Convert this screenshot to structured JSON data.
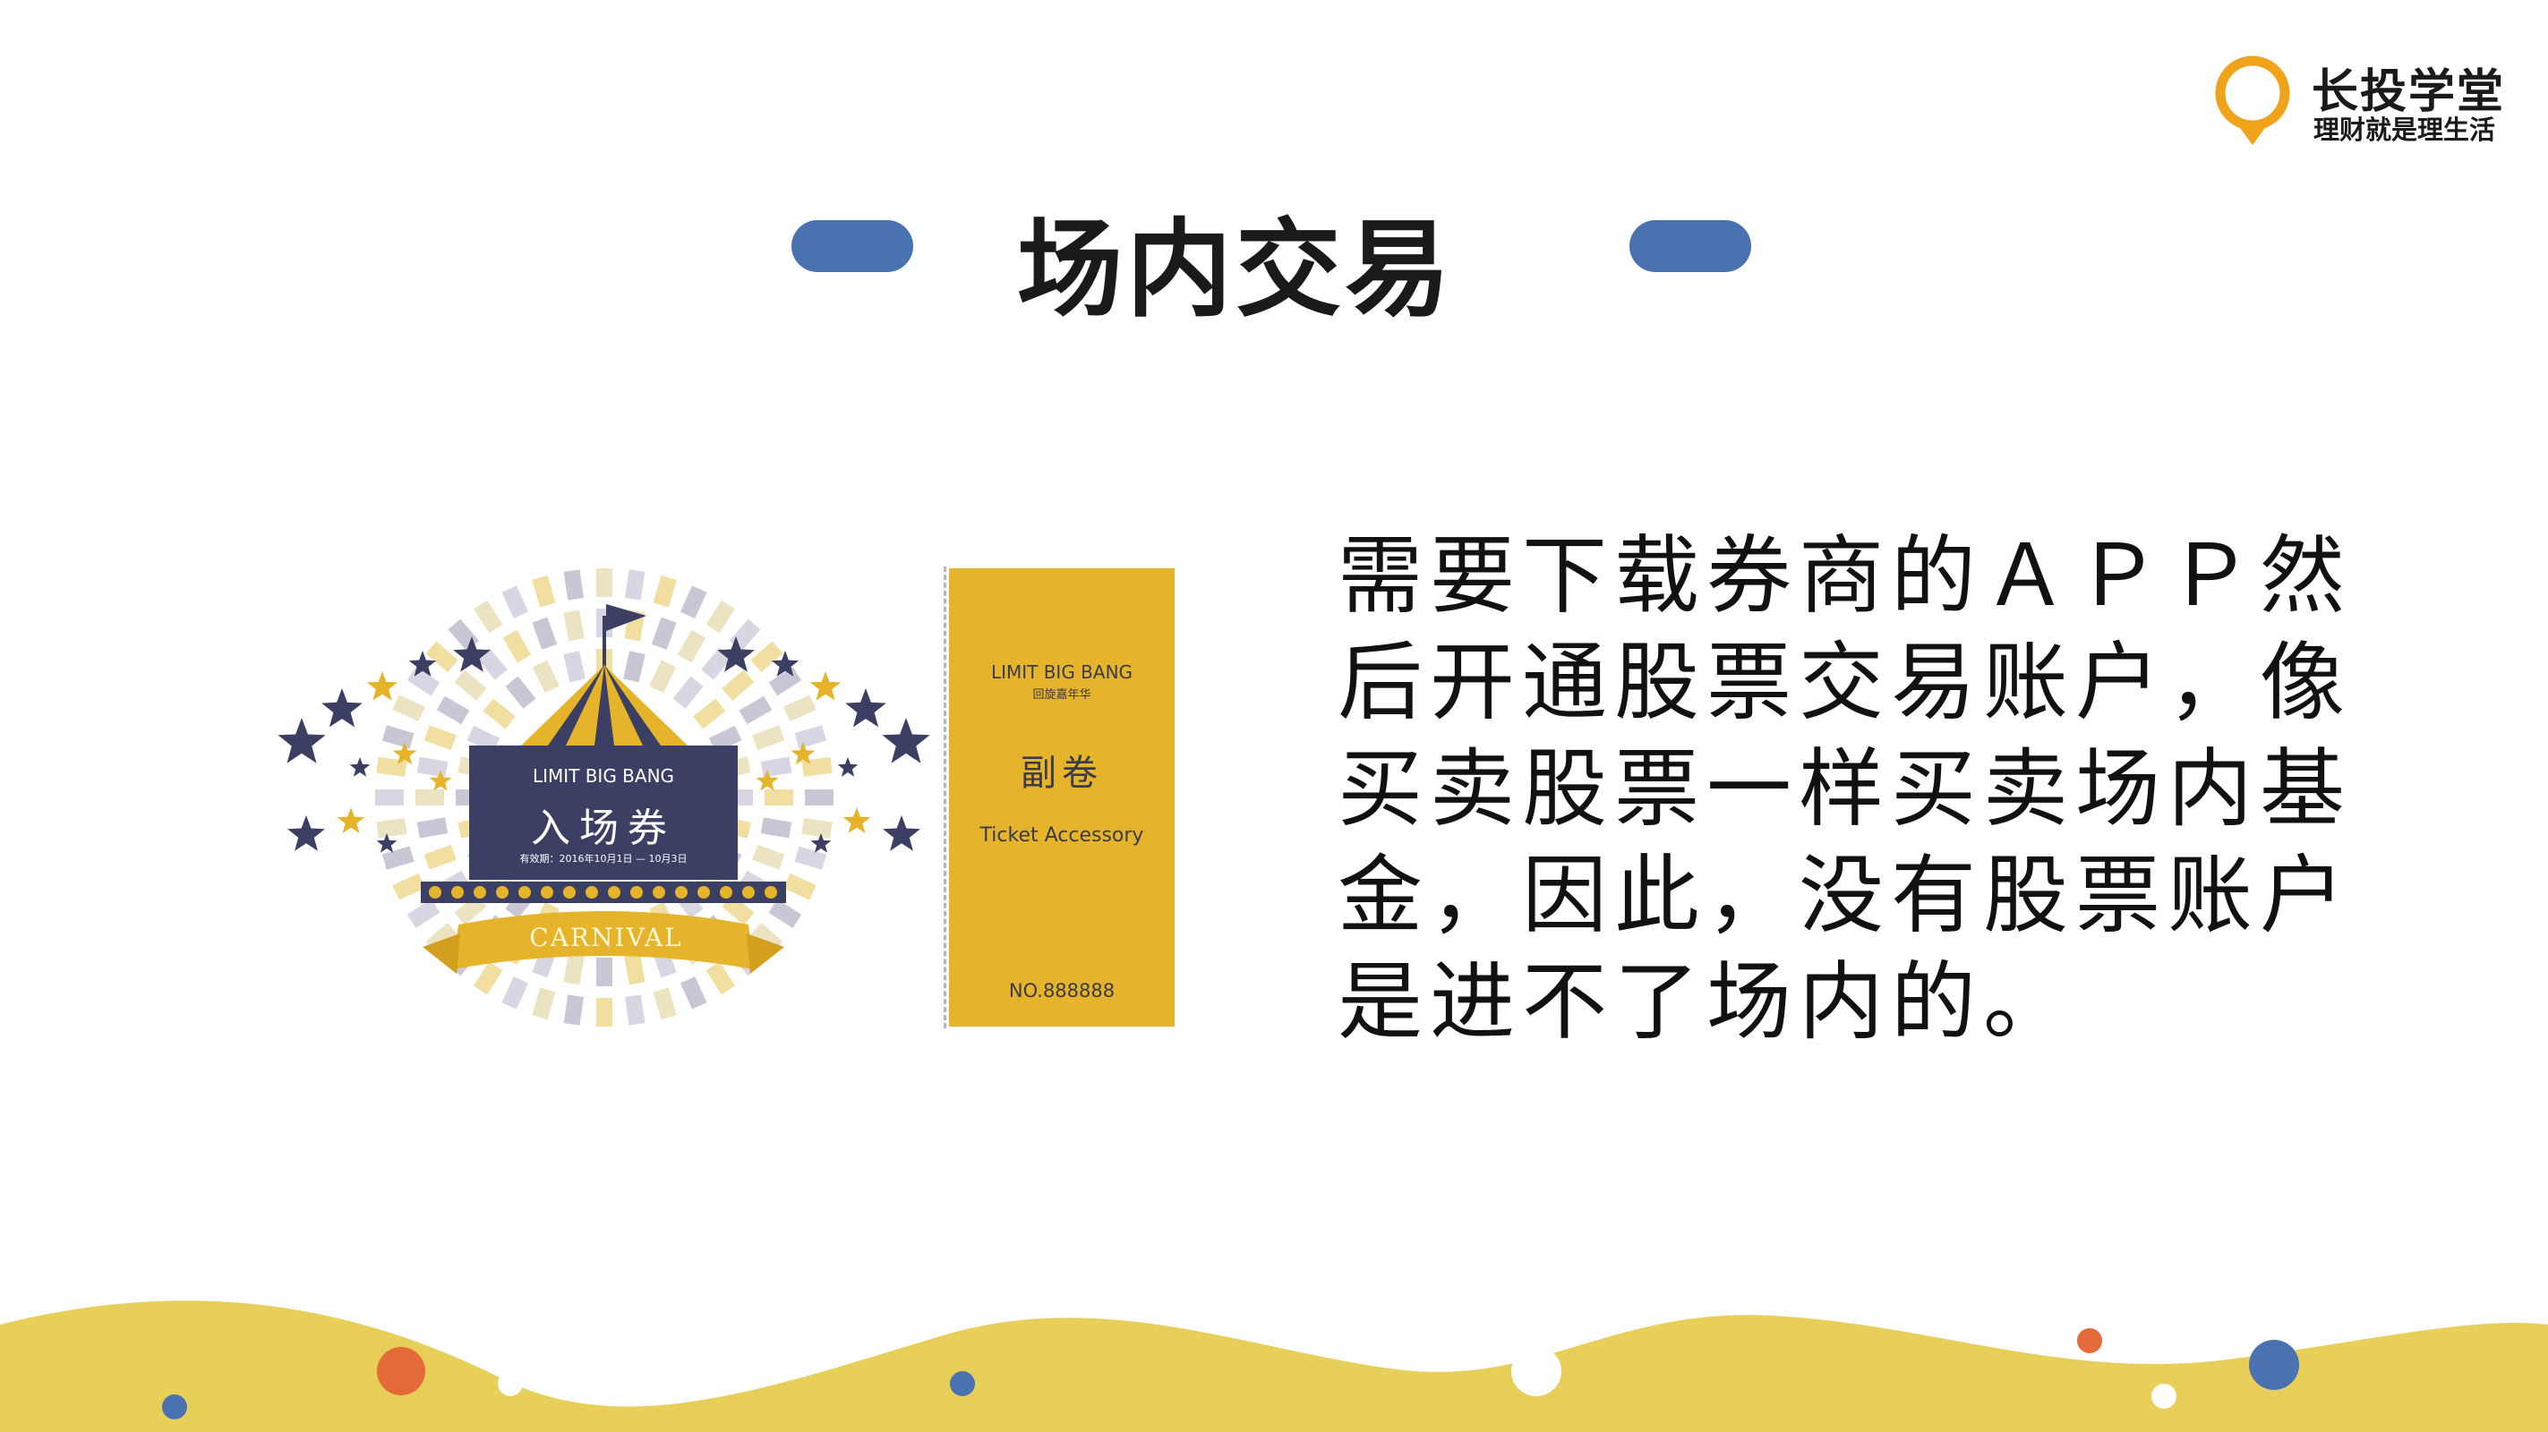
{
  "logo": {
    "name": "长投学堂",
    "slogan": "理财就是理生活",
    "icon": "lightbulb-icon",
    "color": "#f0a21a"
  },
  "slide": {
    "title": "场内交易",
    "accent_color": "#4a72b0",
    "body": "需要下载券商的ＡＰＰ然后开通股票交易账户，像买卖股票一样买卖场内基金，因此，没有股票账户是进不了场内的。"
  },
  "ticket": {
    "main": {
      "brand": "LIMIT BIG BANG",
      "title": "入场券",
      "validity": "有效期：2016年10月1日 — 10月3日",
      "ribbon": "CARNIVAL",
      "navy": "#3b3f63",
      "gold": "#e5b42a"
    },
    "stub": {
      "brand": "LIMIT BIG BANG",
      "brand_sub": "回旋嘉年华",
      "title": "副卷",
      "subtitle": "Ticket Accessory",
      "number": "NO.888888"
    }
  },
  "footer": {
    "wave_color": "#e8cf5a",
    "dot_colors": [
      "#e56a3a",
      "#4a72b0",
      "#ffffff"
    ]
  }
}
